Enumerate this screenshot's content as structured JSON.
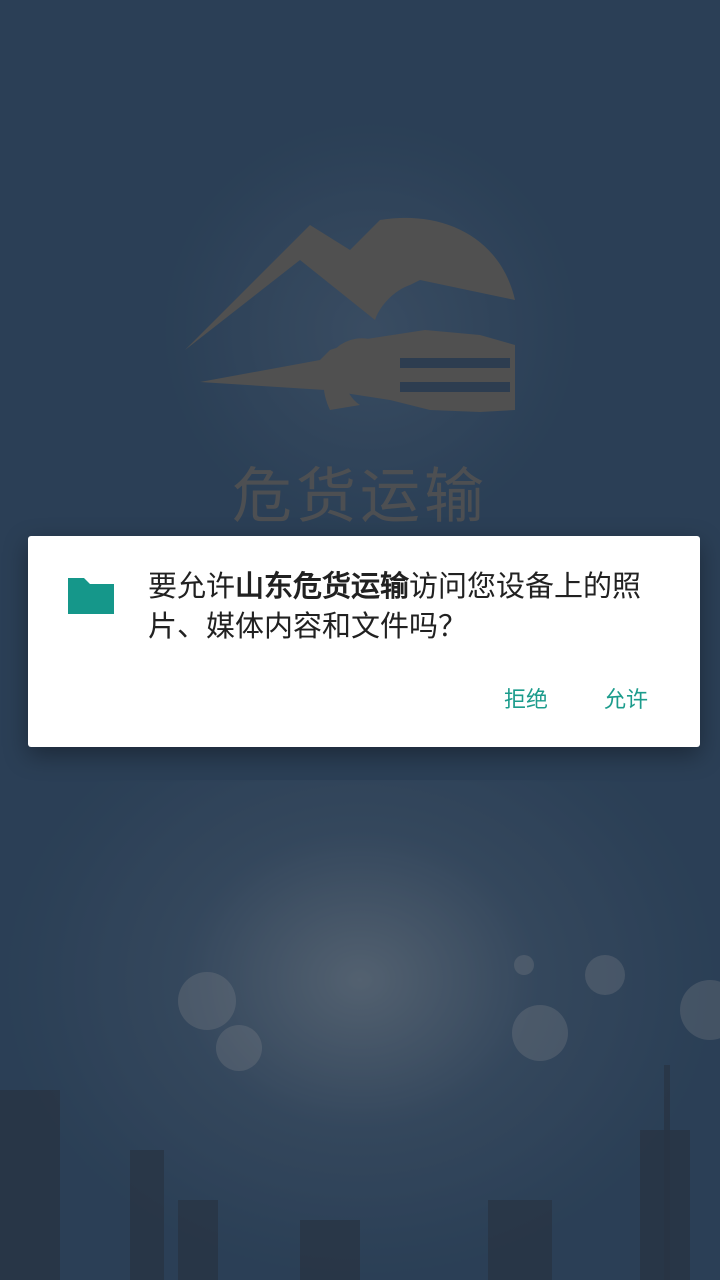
{
  "splash": {
    "title": "危货运输"
  },
  "dialog": {
    "message_prefix": "要允许",
    "app_name": "山东危货运输",
    "message_suffix": "访问您设备上的照片、媒体内容和文件吗？",
    "deny_label": "拒绝",
    "allow_label": "允许",
    "icon": "folder-icon"
  },
  "colors": {
    "accent": "#1c9c8c",
    "background": "#4a6d94",
    "dialog_bg": "#ffffff",
    "text": "#212121"
  }
}
